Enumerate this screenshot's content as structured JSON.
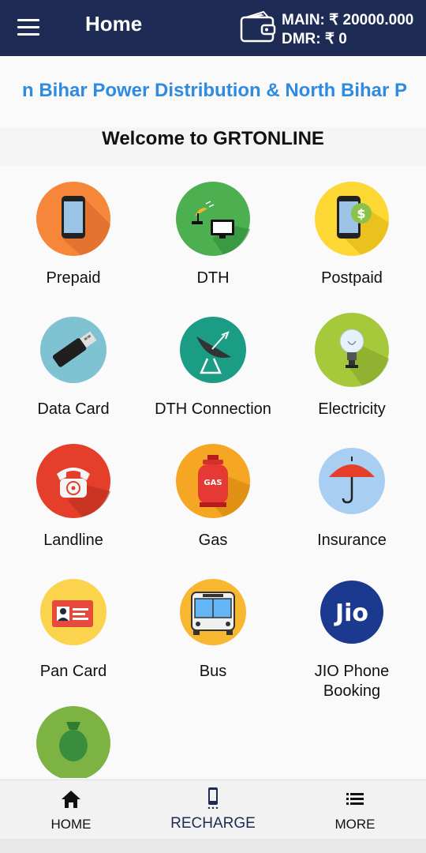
{
  "appbar": {
    "title": "Home",
    "main_balance": "MAIN: ₹ 20000.000",
    "dmr_balance": "DMR: ₹ 0",
    "colors": {
      "background": "#1e2b55",
      "text": "#ffffff"
    }
  },
  "marquee": {
    "text": "n Bihar Power Distribution & North Bihar P",
    "color": "#2e8be0"
  },
  "welcome": "Welcome to GRTONLINE",
  "services": [
    {
      "label": "Prepaid",
      "icon": "mobile-phone-icon"
    },
    {
      "label": "DTH",
      "icon": "satellite-tv-icon"
    },
    {
      "label": "Postpaid",
      "icon": "phone-dollar-icon"
    },
    {
      "label": "Data Card",
      "icon": "usb-dongle-icon"
    },
    {
      "label": "DTH Connection",
      "icon": "satellite-dish-icon"
    },
    {
      "label": "Electricity",
      "icon": "light-bulb-icon"
    },
    {
      "label": "Landline",
      "icon": "telephone-icon"
    },
    {
      "label": "Gas",
      "icon": "gas-cylinder-icon"
    },
    {
      "label": "Insurance",
      "icon": "umbrella-icon"
    },
    {
      "label": "Pan Card",
      "icon": "id-card-icon"
    },
    {
      "label": "Bus",
      "icon": "bus-icon"
    },
    {
      "label": "JIO Phone Booking",
      "icon": "jio-logo-icon"
    },
    {
      "label": "",
      "icon": "money-bag-icon"
    }
  ],
  "jio_logo_text": "Jio",
  "gas_text": "GAS",
  "bottom_nav": [
    {
      "label": "HOME",
      "icon": "home-icon",
      "active": false
    },
    {
      "label": "RECHARGE",
      "icon": "mobile-icon",
      "active": true
    },
    {
      "label": "MORE",
      "icon": "list-icon",
      "active": false
    }
  ]
}
